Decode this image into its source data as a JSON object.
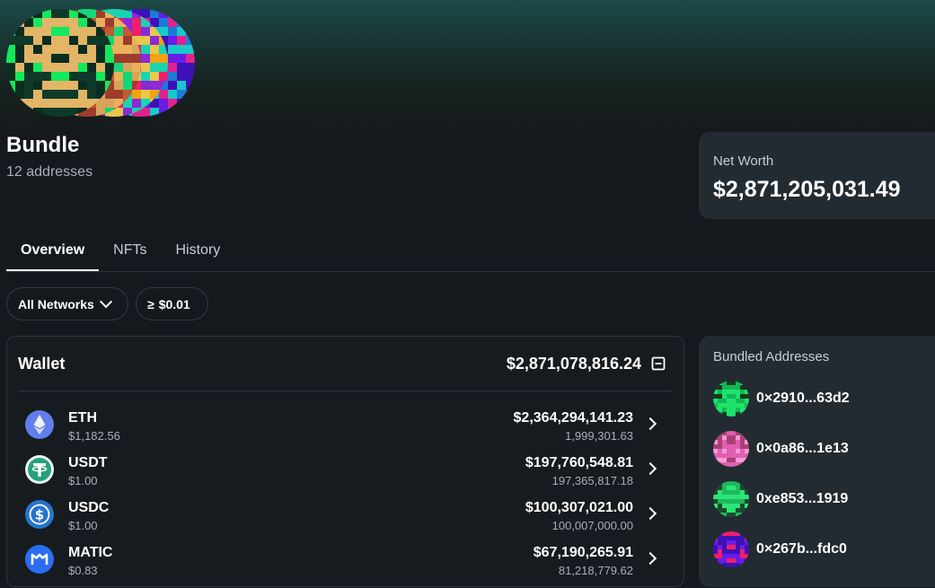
{
  "profile": {
    "title": "Bundle",
    "subtitle": "12 addresses"
  },
  "net_worth": {
    "label": "Net Worth",
    "value": "$2,871,205,031.49"
  },
  "tabs": [
    {
      "label": "Overview",
      "active": true
    },
    {
      "label": "NFTs",
      "active": false
    },
    {
      "label": "History",
      "active": false
    }
  ],
  "filters": {
    "networks": "All Networks",
    "networks_icon": "chevron-down-icon",
    "min_value": "$0.01",
    "min_value_icon": "greater-equal-icon"
  },
  "wallet": {
    "title": "Wallet",
    "total": "$2,871,078,816.24",
    "collapse_icon": "collapse-icon",
    "tokens": [
      {
        "symbol": "ETH",
        "price": "$1,182.56",
        "value": "$2,364,294,141.23",
        "amount": "1,999,301.63",
        "icon": "eth-icon",
        "color": "#627eea"
      },
      {
        "symbol": "USDT",
        "price": "$1.00",
        "value": "$197,760,548.81",
        "amount": "197,365,817.18",
        "icon": "usdt-icon",
        "color": "#26a17b"
      },
      {
        "symbol": "USDC",
        "price": "$1.00",
        "value": "$100,307,021.00",
        "amount": "100,007,000.00",
        "icon": "usdc-icon",
        "color": "#2775ca"
      },
      {
        "symbol": "MATIC",
        "price": "$0.83",
        "value": "$67,190,265.91",
        "amount": "81,218,779.62",
        "icon": "matic-icon",
        "color": "#2b6def"
      }
    ]
  },
  "bundled_addresses": {
    "title": "Bundled Addresses",
    "items": [
      {
        "address": "0×2910...63d2",
        "colors": [
          "#1ee36a",
          "#183a1a",
          "#14b656"
        ]
      },
      {
        "address": "0×0a86...1e13",
        "colors": [
          "#e05fb1",
          "#a84173",
          "#f79ad5"
        ]
      },
      {
        "address": "0xe853...1919",
        "colors": [
          "#2be677",
          "#1b4a2c",
          "#20b85a"
        ]
      },
      {
        "address": "0×267b...fdc0",
        "colors": [
          "#6a1be8",
          "#ef1f6a",
          "#3d11b8"
        ]
      }
    ]
  },
  "colors": {
    "background": "#15191d",
    "card": "#232b32",
    "border": "#2c343b",
    "muted_text": "#a7afb7"
  }
}
